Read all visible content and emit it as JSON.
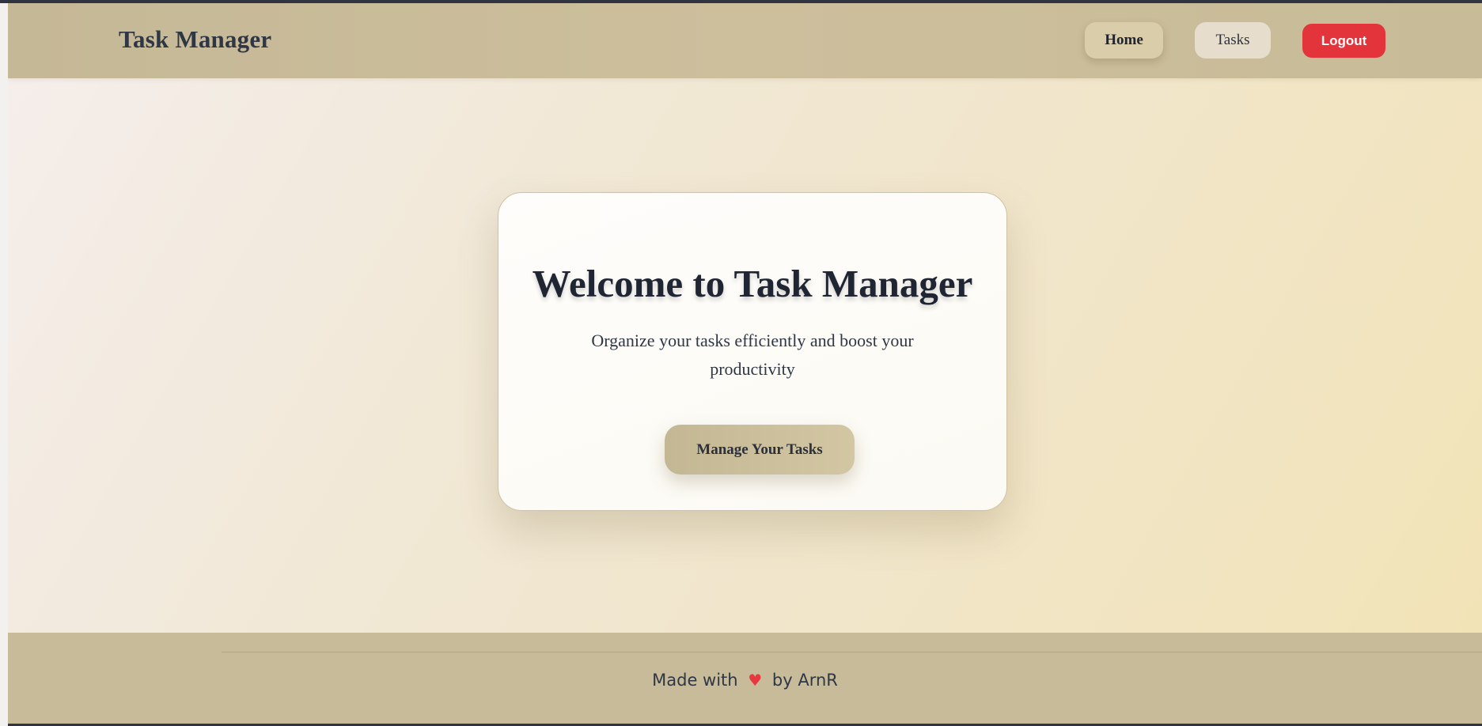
{
  "header": {
    "brand": "Task Manager",
    "nav": {
      "home": "Home",
      "tasks": "Tasks",
      "logout": "Logout"
    }
  },
  "hero": {
    "title": "Welcome to Task Manager",
    "subtitle": "Organize your tasks efficiently and boost your productivity",
    "cta": "Manage Your Tasks"
  },
  "footer": {
    "prefix": "Made with",
    "heart": "♥",
    "suffix": "by ArnR"
  },
  "colors": {
    "accent": "#c8bb99",
    "logout": "#e3343b",
    "heart": "#e8373f"
  },
  "icons": {
    "footer_heart": "heart-icon"
  }
}
